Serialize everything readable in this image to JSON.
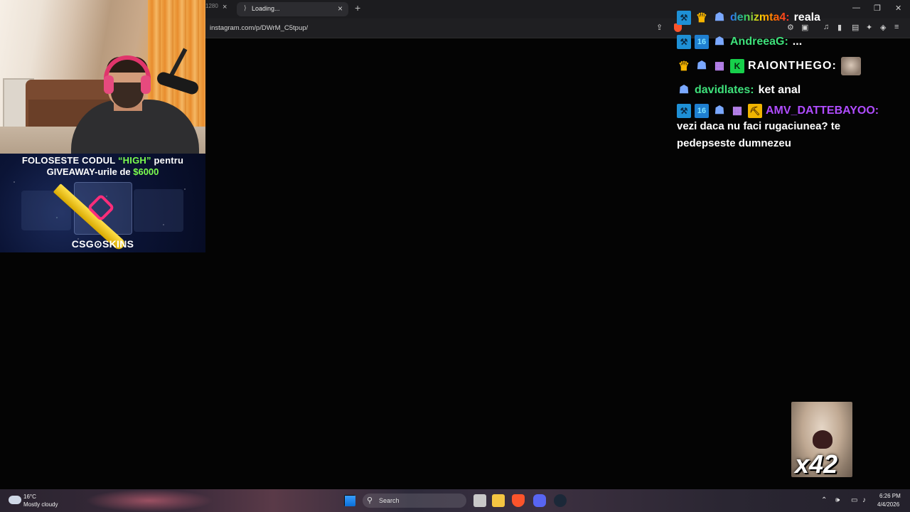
{
  "browser": {
    "prev_tab_label": "1280",
    "active_tab_title": "Loading...",
    "close_glyph": "×",
    "new_tab_glyph": "+",
    "url": "instagram.com/p/DWrM_C5tpup/",
    "window_controls": {
      "minimize": "—",
      "maximize": "❐",
      "close": "✕"
    }
  },
  "promo": {
    "line1_prefix": "FOLOSESTE CODUL ",
    "line1_code": "“HIGH”",
    "line1_suffix": " pentru",
    "line2_prefix": "GIVEAWAY-urile de ",
    "line2_amount": "$6000",
    "brand": "CSG⊙SKINS"
  },
  "chat": {
    "messages": [
      {
        "username": "denizmta4:",
        "text": "reala",
        "username_style": "rainbow"
      },
      {
        "username": "AndreeaG:",
        "text": "...",
        "username_color": "#3ee07a"
      },
      {
        "username": "RAIONTHEGO:",
        "text": "",
        "username_color": "#ffffff"
      },
      {
        "username": "davidlates:",
        "text": "ket anal",
        "username_color": "#3ee07a"
      },
      {
        "username": "AMV_DATTEBAYOO:",
        "text": "vezi daca nu faci rugaciunea? te pedepseste dumnezeu",
        "username_color": "#b04cff"
      }
    ]
  },
  "emote_overlay": {
    "count": "x42"
  },
  "taskbar": {
    "weather_temp": "16°C",
    "weather_desc": "Mostly cloudy",
    "search_label": "Search",
    "time": "6:26 PM",
    "date": "4/4/2026"
  },
  "colors": {
    "background": "#040404",
    "accent_green": "#7cff4f",
    "chat_green": "#3ee07a",
    "chat_purple": "#b04cff"
  },
  "icons": [
    "share-icon",
    "brave-shield-icon",
    "extensions-icon",
    "music-icon",
    "sidebar-icon",
    "wallet-icon",
    "leo-icon",
    "vpn-icon",
    "menu-icon",
    "weather-cloud-icon",
    "start-icon",
    "search-icon",
    "volume-icon",
    "wifi-icon"
  ]
}
